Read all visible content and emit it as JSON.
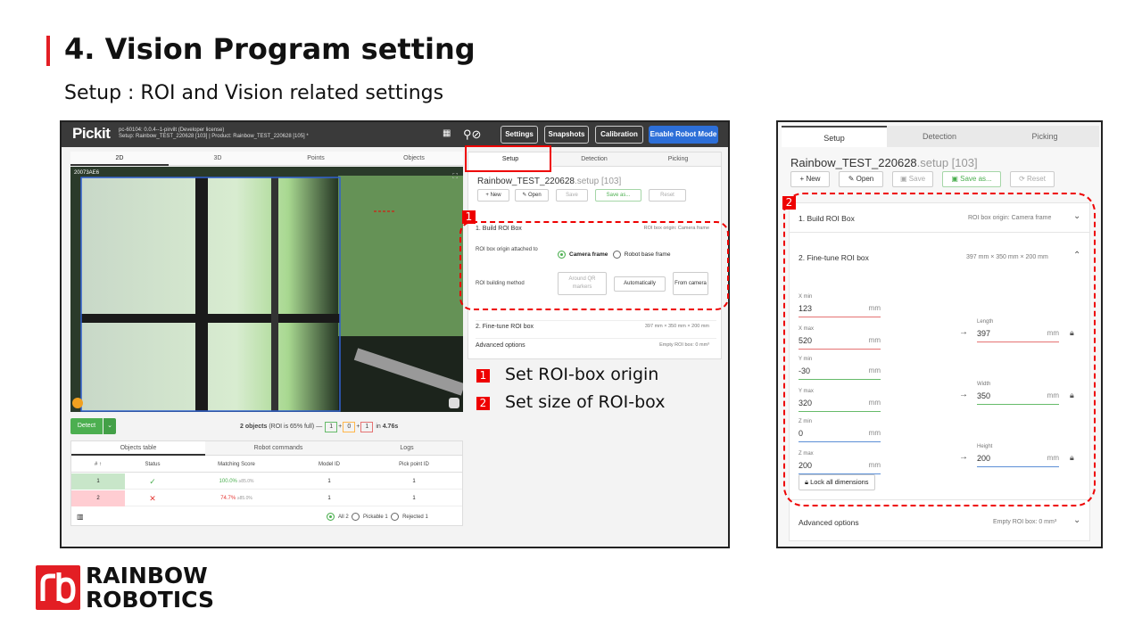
{
  "slide": {
    "title": "4. Vision Program setting",
    "subtitle": "Setup : ROI and Vision related settings"
  },
  "app": {
    "logo": "Pickit",
    "status_line1": "pc-60104: 0.0.4--1-pirvilt (Developer license)",
    "status_line2": "Setup: Rainbow_TEST_220628 [103] | Product: Rainbow_TEST_220628 [105] *",
    "buttons": {
      "settings": "Settings",
      "snapshots": "Snapshots",
      "calibration": "Calibration",
      "robot_mode": "Enable Robot Mode"
    },
    "view_tabs": [
      "2D",
      "3D",
      "Points",
      "Objects"
    ],
    "viewport_label": "20073AE6",
    "detect": "Detect",
    "objects_summary": {
      "count_text": "2 objects",
      "roi_text": "(ROI is 65% full)",
      "a": "1",
      "b": "0",
      "c": "1",
      "time_prefix": "in",
      "time": "4.76s"
    },
    "table_tabs": [
      "Objects table",
      "Robot commands",
      "Logs"
    ],
    "table_headers": [
      "# ↑",
      "Status",
      "Matching Score",
      "Model ID",
      "Pick point ID"
    ],
    "rows": [
      {
        "num": "1",
        "status": "✓",
        "score": "100.0%",
        "score_sub": "≥85.0%",
        "model": "1",
        "pick": "1"
      },
      {
        "num": "2",
        "status": "✕",
        "score": "74.7%",
        "score_sub": "≥85.0%",
        "model": "1",
        "pick": "1"
      }
    ],
    "filters": {
      "all": "All",
      "all_n": "2",
      "pickable": "Pickable",
      "pickable_n": "1",
      "rejected": "Rejected",
      "rejected_n": "1"
    },
    "setup_tabs": [
      "Setup",
      "Detection",
      "Picking"
    ],
    "setup_name": "Rainbow_TEST_220628",
    "setup_ext": ".setup [103]",
    "setup_buttons": {
      "new": "+ New",
      "open": "✎ Open",
      "save": "Save",
      "save_as": "Save as...",
      "reset": "Reset"
    },
    "build_roi": "1. Build ROI Box",
    "roi_origin_right": "ROI box origin: Camera frame",
    "origin_label": "ROI box origin attached to",
    "camera_frame": "Camera frame",
    "robot_frame": "Robot base frame",
    "building_method": "ROI building method",
    "around_qr": "Around QR markers",
    "automatically": "Automatically",
    "from_camera": "From camera",
    "fine_tune": "2. Fine-tune ROI box",
    "fine_tune_right": "397 mm × 350 mm × 200 mm",
    "advanced": "Advanced options",
    "advanced_right": "Empty ROI box: 0 mm³"
  },
  "legend": {
    "tag1": "1",
    "text1": "Set ROI-box origin",
    "tag2": "2",
    "text2": "Set size of ROI-box"
  },
  "right_panel": {
    "tabs": [
      "Setup",
      "Detection",
      "Picking"
    ],
    "name": "Rainbow_TEST_220628",
    "ext": ".setup [103]",
    "buttons": {
      "new": "New",
      "open": "Open",
      "save": "Save",
      "save_as": "Save as...",
      "reset": "Reset"
    },
    "tag": "2",
    "build_roi": "1. Build ROI Box",
    "build_roi_right": "ROI box origin: Camera frame",
    "fine_tune": "2. Fine-tune ROI box",
    "fine_tune_right": "397 mm × 350 mm × 200 mm",
    "fields": [
      {
        "label": "X min",
        "value": "123",
        "unit": "mm",
        "color": "#e57373"
      },
      {
        "label": "X max",
        "value": "520",
        "unit": "mm",
        "color": "#e57373"
      },
      {
        "label": "Y min",
        "value": "-30",
        "unit": "mm",
        "color": "#66bb6a"
      },
      {
        "label": "Y max",
        "value": "320",
        "unit": "mm",
        "color": "#66bb6a"
      },
      {
        "label": "Z min",
        "value": "0",
        "unit": "mm",
        "color": "#5c8fd6"
      },
      {
        "label": "Z max",
        "value": "200",
        "unit": "mm",
        "color": "#5c8fd6"
      }
    ],
    "dims": [
      {
        "label": "Length",
        "value": "397",
        "unit": "mm",
        "color": "#e57373"
      },
      {
        "label": "Width",
        "value": "350",
        "unit": "mm",
        "color": "#66bb6a"
      },
      {
        "label": "Height",
        "value": "200",
        "unit": "mm",
        "color": "#5c8fd6"
      }
    ],
    "lock_all": "Lock all dimensions",
    "advanced": "Advanced options",
    "advanced_right": "Empty ROI box: 0 mm³"
  },
  "company": {
    "line1": "RAINBOW",
    "line2": "ROBOTICS"
  }
}
